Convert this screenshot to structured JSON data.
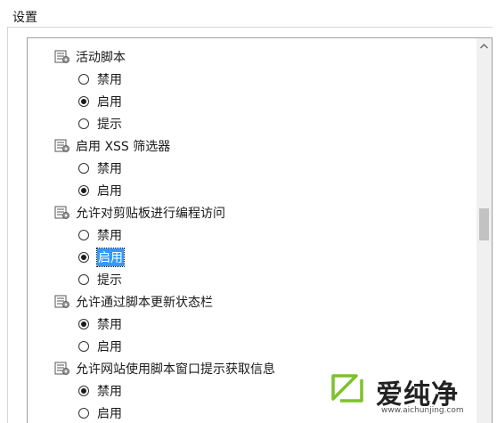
{
  "group_title": "设置",
  "settings": [
    {
      "title": "活动脚本",
      "options": [
        {
          "label": "禁用",
          "checked": false,
          "highlighted": false
        },
        {
          "label": "启用",
          "checked": true,
          "highlighted": false
        },
        {
          "label": "提示",
          "checked": false,
          "highlighted": false
        }
      ]
    },
    {
      "title": "启用 XSS 筛选器",
      "options": [
        {
          "label": "禁用",
          "checked": false,
          "highlighted": false
        },
        {
          "label": "启用",
          "checked": true,
          "highlighted": false
        }
      ]
    },
    {
      "title": "允许对剪贴板进行编程访问",
      "options": [
        {
          "label": "禁用",
          "checked": false,
          "highlighted": false
        },
        {
          "label": "启用",
          "checked": true,
          "highlighted": true
        },
        {
          "label": "提示",
          "checked": false,
          "highlighted": false
        }
      ]
    },
    {
      "title": "允许通过脚本更新状态栏",
      "options": [
        {
          "label": "禁用",
          "checked": true,
          "highlighted": false
        },
        {
          "label": "启用",
          "checked": false,
          "highlighted": false
        }
      ]
    },
    {
      "title": "允许网站使用脚本窗口提示获取信息",
      "options": [
        {
          "label": "禁用",
          "checked": true,
          "highlighted": false
        },
        {
          "label": "启用",
          "checked": false,
          "highlighted": false
        }
      ]
    }
  ],
  "scrollbar": {
    "position_fraction": 0.48
  },
  "watermark": {
    "brand": "爱纯净",
    "url": "www.aichunjing.com",
    "accent": "#7cc22a"
  },
  "colors": {
    "highlight": "#3399ff",
    "border": "#a0a0a0",
    "text": "#1a1a1a"
  },
  "icons": {
    "setting": "script-setting-icon",
    "scroll_up": "chevron-up-icon"
  }
}
